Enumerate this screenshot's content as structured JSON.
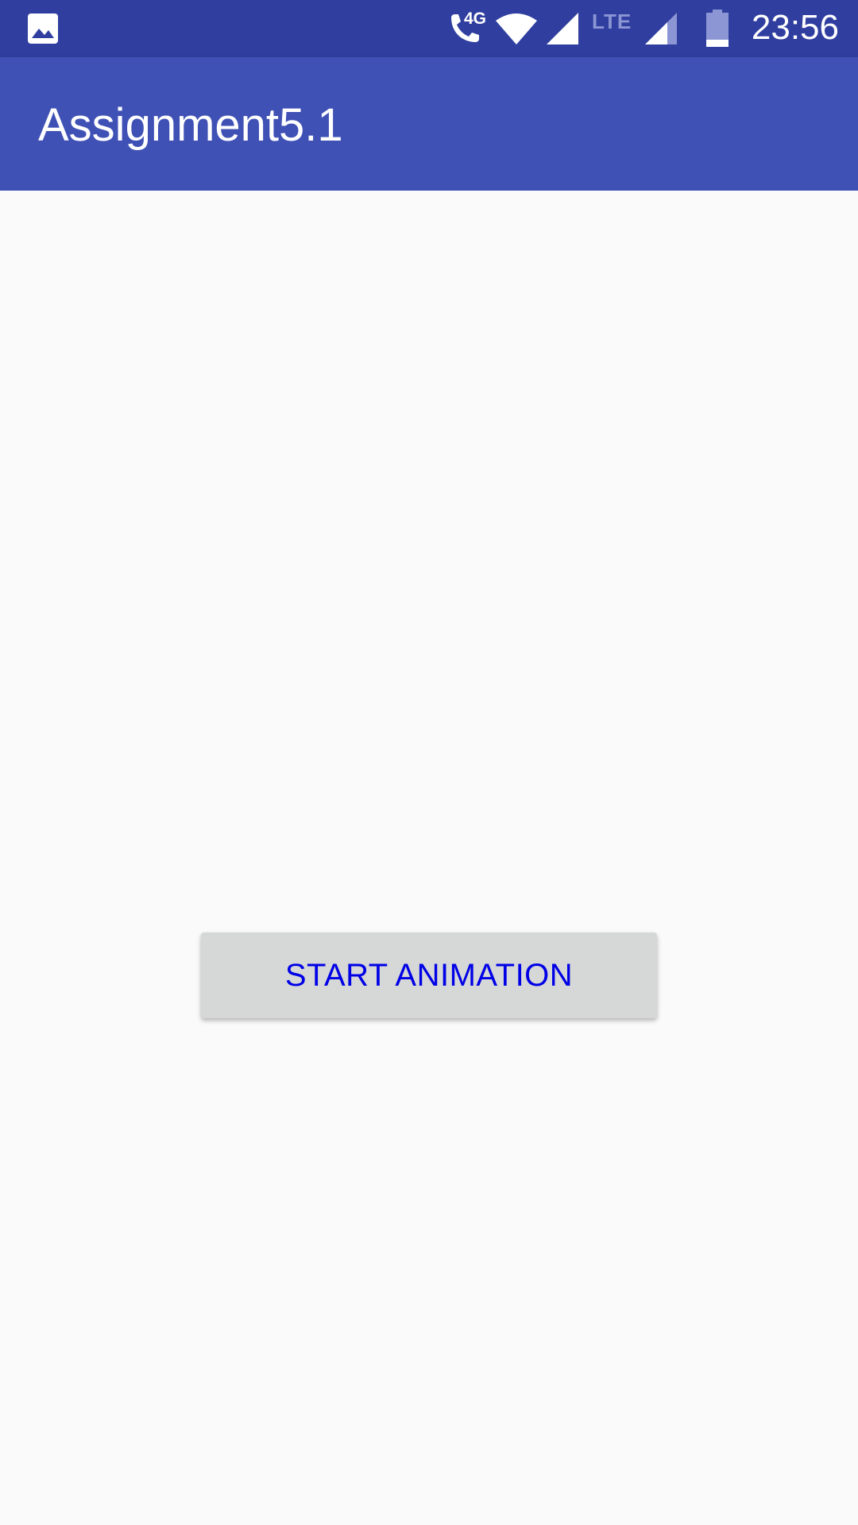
{
  "status_bar": {
    "clock": "23:56",
    "call_network_label": "4G",
    "lte_label": "LTE",
    "icons": [
      "gallery-icon",
      "call-icon",
      "wifi-icon",
      "signal-icon",
      "signal-icon",
      "battery-icon"
    ],
    "background_color": "#303f9f"
  },
  "app_bar": {
    "title": "Assignment5.1",
    "background_color": "#3f51b5"
  },
  "main": {
    "start_button_label": "START ANIMATION",
    "button_text_color": "#0000e6",
    "button_background_color": "#d6d7d7"
  }
}
